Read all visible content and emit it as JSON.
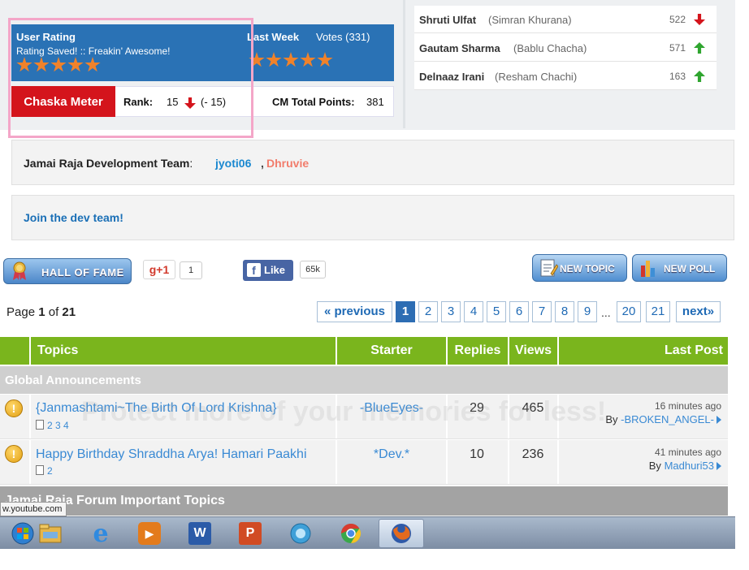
{
  "rating": {
    "title": "User Rating",
    "saved_text": "Rating Saved! :: Freakin' Awesome!",
    "last_week_label": "Last Week",
    "votes_label": "Votes (331)",
    "user_stars": 5,
    "week_stars": 5,
    "star_color": "#f0822a"
  },
  "meter": {
    "label": "Chaska Meter",
    "rank_label": "Rank:",
    "rank_value": "15",
    "rank_change": "(- 15)",
    "cm_label": "CM Total Points:",
    "cm_value": "381"
  },
  "top_list": [
    {
      "name": "Shruti Ulfat",
      "role": "(Simran Khurana)",
      "count": "522",
      "trend": "down"
    },
    {
      "name": "Gautam Sharma",
      "role": "(Bablu Chacha)",
      "count": "571",
      "trend": "up"
    },
    {
      "name": "Delnaaz Irani",
      "role": "(Resham Chachi)",
      "count": "163",
      "trend": "up"
    }
  ],
  "dev_team": {
    "label": "Jamai Raja Development Team",
    "colon": ":",
    "member1": "jyoti06",
    "comma": ",",
    "member2": "Dhruvie"
  },
  "join": {
    "label": "Join the dev team!"
  },
  "buttons": {
    "hall_of_fame": "HALL OF FAME",
    "gplus": "g+1",
    "gplus_count": "1",
    "fb_f": "f",
    "fb_like": "Like",
    "fb_count": "65k",
    "new_topic": "NEW TOPIC",
    "new_poll": "NEW POLL"
  },
  "pagination": {
    "page_prefix": "Page",
    "current": "1",
    "of_text": "of",
    "total": "21",
    "previous": "« previous",
    "pages": [
      "1",
      "2",
      "3",
      "4",
      "5",
      "6",
      "7",
      "8",
      "9"
    ],
    "ellipsis": "...",
    "tail": [
      "20",
      "21"
    ],
    "next": "next»"
  },
  "table": {
    "headers": {
      "topics": "Topics",
      "starter": "Starter",
      "replies": "Replies",
      "views": "Views",
      "last_post": "Last Post"
    },
    "header_color": "#7ab51d",
    "announcements_label": "Global Announcements",
    "rows": [
      {
        "icon": "!",
        "title": "{Janmashtami~The Birth Of Lord Krishna}",
        "pages": "2 3 4",
        "starter": "-BlueEyes-",
        "replies": "29",
        "views": "465",
        "time": "16 minutes ago",
        "by": "By",
        "user": "-BROKEN_ANGEL-"
      },
      {
        "icon": "!",
        "title": "Happy Birthday Shraddha Arya! Hamari Paakhi",
        "pages": "2",
        "starter": "*Dev.*",
        "replies": "10",
        "views": "236",
        "time": "41 minutes ago",
        "by": "By",
        "user": "Madhuri53"
      }
    ],
    "section_label": "Jamai Raja Forum Important Topics"
  },
  "status_url": "w.youtube.com",
  "taskbar": [
    {
      "name": "start-orb-icon",
      "glyph": "",
      "color": "#2f7fd0"
    },
    {
      "name": "explorer-icon",
      "glyph": "",
      "color": "#e6b64a"
    },
    {
      "name": "ie-icon",
      "glyph": "e",
      "color": "#2f8ae0"
    },
    {
      "name": "media-player-icon",
      "glyph": "▶",
      "color": "#e37b1c"
    },
    {
      "name": "word-icon",
      "glyph": "W",
      "color": "#2b5ba8"
    },
    {
      "name": "powerpoint-icon",
      "glyph": "P",
      "color": "#d14b24"
    },
    {
      "name": "app-orb-icon",
      "glyph": "",
      "color": "#3fa0d8"
    },
    {
      "name": "chrome-icon",
      "glyph": "",
      "color": "#3aa84a"
    },
    {
      "name": "firefox-icon",
      "glyph": "",
      "color": "#e36a1e"
    }
  ],
  "watermark_text": "Protect more of your memories for less!"
}
